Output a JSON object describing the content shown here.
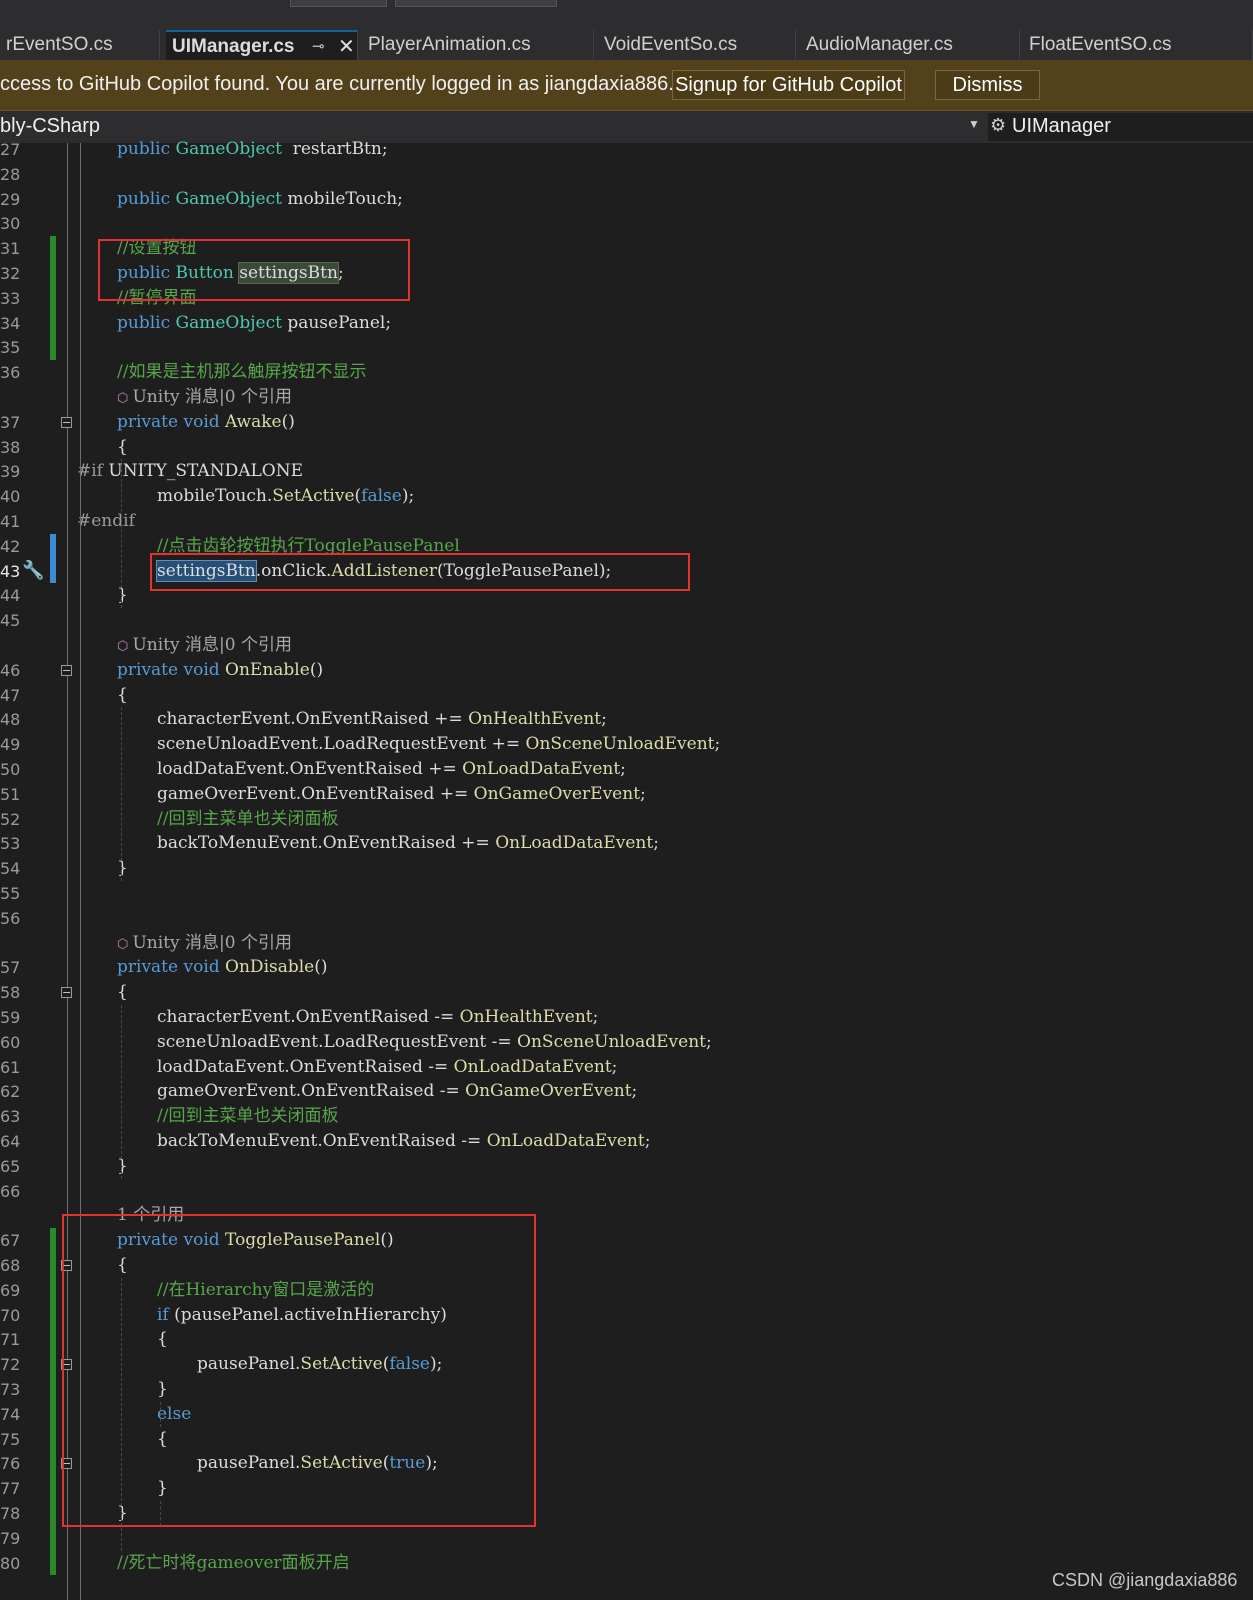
{
  "tabs": [
    {
      "label": "rEventSO.cs",
      "active": false
    },
    {
      "label": "UIManager.cs",
      "active": true
    },
    {
      "label": "PlayerAnimation.cs",
      "active": false
    },
    {
      "label": "VoidEventSo.cs",
      "active": false
    },
    {
      "label": "AudioManager.cs",
      "active": false
    },
    {
      "label": "FloatEventSO.cs",
      "active": false
    }
  ],
  "tab_icons": {
    "pin": "⊸",
    "close": "✕"
  },
  "infobar": {
    "message": "ccess to GitHub Copilot found. You are currently logged in as jiangdaxia886.",
    "signup_label": "Signup for GitHub Copilot",
    "dismiss_label": "Dismiss"
  },
  "navbar": {
    "project": "bly-CSharp",
    "dropdown_arrow": "▼",
    "class_icon": "⚙",
    "class_name": "UIManager"
  },
  "code_lines": [
    {
      "n": "27",
      "indent": 4,
      "tokens": [
        [
          "k",
          "public "
        ],
        [
          "t",
          "GameObject"
        ],
        [
          "",
          "  restartBtn;"
        ]
      ]
    },
    {
      "n": "28",
      "indent": 0,
      "tokens": []
    },
    {
      "n": "29",
      "indent": 4,
      "tokens": [
        [
          "k",
          "public "
        ],
        [
          "t",
          "GameObject"
        ],
        [
          "",
          " mobileTouch;"
        ]
      ]
    },
    {
      "n": "30",
      "indent": 0,
      "tokens": []
    },
    {
      "n": "31",
      "indent": 4,
      "tokens": [
        [
          "c",
          "//设置按钮"
        ]
      ]
    },
    {
      "n": "32",
      "indent": 4,
      "tokens": [
        [
          "k",
          "public "
        ],
        [
          "t",
          "Button"
        ],
        [
          "",
          " "
        ],
        [
          "hl1",
          "settingsBtn"
        ],
        [
          "",
          ";"
        ]
      ]
    },
    {
      "n": "33",
      "indent": 4,
      "tokens": [
        [
          "c",
          "//暂停界面"
        ]
      ]
    },
    {
      "n": "34",
      "indent": 4,
      "tokens": [
        [
          "k",
          "public "
        ],
        [
          "t",
          "GameObject"
        ],
        [
          "",
          " pausePanel;"
        ]
      ]
    },
    {
      "n": "35",
      "indent": 0,
      "tokens": []
    },
    {
      "n": "36",
      "indent": 4,
      "tokens": [
        [
          "c",
          "//如果是主机那么触屏按钮不显示"
        ]
      ]
    },
    {
      "n": "",
      "indent": 4,
      "tokens": [
        [
          "cube",
          "⬡ "
        ],
        [
          "hint",
          "Unity 消息|0 个引用"
        ]
      ]
    },
    {
      "n": "37",
      "indent": 4,
      "tokens": [
        [
          "k",
          "private void "
        ],
        [
          "m",
          "Awake"
        ],
        [
          "",
          "()"
        ]
      ]
    },
    {
      "n": "38",
      "indent": 4,
      "tokens": [
        [
          "",
          "{"
        ]
      ]
    },
    {
      "n": "39",
      "indent": 0,
      "tokens": [
        [
          "p",
          "#if "
        ],
        [
          "",
          "UNITY_STANDALONE"
        ]
      ]
    },
    {
      "n": "40",
      "indent": 8,
      "tokens": [
        [
          "",
          "mobileTouch."
        ],
        [
          "m",
          "SetActive"
        ],
        [
          "",
          "("
        ],
        [
          "k",
          "false"
        ],
        [
          "",
          ");"
        ]
      ]
    },
    {
      "n": "41",
      "indent": 0,
      "tokens": [
        [
          "p",
          "#endif"
        ]
      ]
    },
    {
      "n": "42",
      "indent": 8,
      "tokens": [
        [
          "c",
          "//点击齿轮按钮执行TogglePausePanel"
        ]
      ]
    },
    {
      "n": "43",
      "indent": 8,
      "tokens": [
        [
          "hl2",
          "settingsBtn"
        ],
        [
          "",
          ".onClick."
        ],
        [
          "m",
          "AddListener"
        ],
        [
          "",
          "(TogglePausePanel);"
        ]
      ]
    },
    {
      "n": "44",
      "indent": 4,
      "tokens": [
        [
          "",
          "}"
        ]
      ]
    },
    {
      "n": "45",
      "indent": 0,
      "tokens": []
    },
    {
      "n": "",
      "indent": 4,
      "tokens": [
        [
          "cube",
          "⬡ "
        ],
        [
          "hint",
          "Unity 消息|0 个引用"
        ]
      ]
    },
    {
      "n": "46",
      "indent": 4,
      "tokens": [
        [
          "k",
          "private void "
        ],
        [
          "m",
          "OnEnable"
        ],
        [
          "",
          "()"
        ]
      ]
    },
    {
      "n": "47",
      "indent": 4,
      "tokens": [
        [
          "",
          "{"
        ]
      ]
    },
    {
      "n": "48",
      "indent": 8,
      "tokens": [
        [
          "",
          "characterEvent.OnEventRaised += "
        ],
        [
          "m",
          "OnHealthEvent"
        ],
        [
          "",
          ";"
        ]
      ]
    },
    {
      "n": "49",
      "indent": 8,
      "tokens": [
        [
          "",
          "sceneUnloadEvent.LoadRequestEvent += "
        ],
        [
          "m",
          "OnSceneUnloadEvent"
        ],
        [
          "",
          ";"
        ]
      ]
    },
    {
      "n": "50",
      "indent": 8,
      "tokens": [
        [
          "",
          "loadDataEvent.OnEventRaised += "
        ],
        [
          "m",
          "OnLoadDataEvent"
        ],
        [
          "",
          ";"
        ]
      ]
    },
    {
      "n": "51",
      "indent": 8,
      "tokens": [
        [
          "",
          "gameOverEvent.OnEventRaised += "
        ],
        [
          "m",
          "OnGameOverEvent"
        ],
        [
          "",
          ";"
        ]
      ]
    },
    {
      "n": "52",
      "indent": 8,
      "tokens": [
        [
          "c",
          "//回到主菜单也关闭面板"
        ]
      ]
    },
    {
      "n": "53",
      "indent": 8,
      "tokens": [
        [
          "",
          "backToMenuEvent.OnEventRaised += "
        ],
        [
          "m",
          "OnLoadDataEvent"
        ],
        [
          "",
          ";"
        ]
      ]
    },
    {
      "n": "54",
      "indent": 4,
      "tokens": [
        [
          "",
          "}"
        ]
      ]
    },
    {
      "n": "55",
      "indent": 0,
      "tokens": []
    },
    {
      "n": "56",
      "indent": 0,
      "tokens": []
    },
    {
      "n": "",
      "indent": 4,
      "tokens": [
        [
          "cube",
          "⬡ "
        ],
        [
          "hint",
          "Unity 消息|0 个引用"
        ]
      ]
    },
    {
      "n": "57",
      "indent": 4,
      "tokens": [
        [
          "k",
          "private void "
        ],
        [
          "m",
          "OnDisable"
        ],
        [
          "",
          "()"
        ]
      ]
    },
    {
      "n": "58",
      "indent": 4,
      "tokens": [
        [
          "",
          "{"
        ]
      ]
    },
    {
      "n": "59",
      "indent": 8,
      "tokens": [
        [
          "",
          "characterEvent.OnEventRaised -= "
        ],
        [
          "m",
          "OnHealthEvent"
        ],
        [
          "",
          ";"
        ]
      ]
    },
    {
      "n": "60",
      "indent": 8,
      "tokens": [
        [
          "",
          "sceneUnloadEvent.LoadRequestEvent -= "
        ],
        [
          "m",
          "OnSceneUnloadEvent"
        ],
        [
          "",
          ";"
        ]
      ]
    },
    {
      "n": "61",
      "indent": 8,
      "tokens": [
        [
          "",
          "loadDataEvent.OnEventRaised -= "
        ],
        [
          "m",
          "OnLoadDataEvent"
        ],
        [
          "",
          ";"
        ]
      ]
    },
    {
      "n": "62",
      "indent": 8,
      "tokens": [
        [
          "",
          "gameOverEvent.OnEventRaised -= "
        ],
        [
          "m",
          "OnGameOverEvent"
        ],
        [
          "",
          ";"
        ]
      ]
    },
    {
      "n": "63",
      "indent": 8,
      "tokens": [
        [
          "c",
          "//回到主菜单也关闭面板"
        ]
      ]
    },
    {
      "n": "64",
      "indent": 8,
      "tokens": [
        [
          "",
          "backToMenuEvent.OnEventRaised -= "
        ],
        [
          "m",
          "OnLoadDataEvent"
        ],
        [
          "",
          ";"
        ]
      ]
    },
    {
      "n": "65",
      "indent": 4,
      "tokens": [
        [
          "",
          "}"
        ]
      ]
    },
    {
      "n": "66",
      "indent": 0,
      "tokens": []
    },
    {
      "n": "",
      "indent": 4,
      "tokens": [
        [
          "hint",
          "1 个引用"
        ]
      ]
    },
    {
      "n": "67",
      "indent": 4,
      "tokens": [
        [
          "k",
          "private void "
        ],
        [
          "m",
          "TogglePausePanel"
        ],
        [
          "",
          "()"
        ]
      ]
    },
    {
      "n": "68",
      "indent": 4,
      "tokens": [
        [
          "",
          "{"
        ]
      ]
    },
    {
      "n": "69",
      "indent": 8,
      "tokens": [
        [
          "c",
          "//在Hierarchy窗口是激活的"
        ]
      ]
    },
    {
      "n": "70",
      "indent": 8,
      "tokens": [
        [
          "k",
          "if "
        ],
        [
          "",
          "(pausePanel.activeInHierarchy)"
        ]
      ]
    },
    {
      "n": "71",
      "indent": 8,
      "tokens": [
        [
          "",
          "{"
        ]
      ]
    },
    {
      "n": "72",
      "indent": 12,
      "tokens": [
        [
          "",
          "pausePanel."
        ],
        [
          "m",
          "SetActive"
        ],
        [
          "",
          "("
        ],
        [
          "k",
          "false"
        ],
        [
          "",
          ");"
        ]
      ]
    },
    {
      "n": "73",
      "indent": 8,
      "tokens": [
        [
          "",
          "}"
        ]
      ]
    },
    {
      "n": "74",
      "indent": 8,
      "tokens": [
        [
          "k",
          "else"
        ]
      ]
    },
    {
      "n": "75",
      "indent": 8,
      "tokens": [
        [
          "",
          "{"
        ]
      ]
    },
    {
      "n": "76",
      "indent": 12,
      "tokens": [
        [
          "",
          "pausePanel."
        ],
        [
          "m",
          "SetActive"
        ],
        [
          "",
          "("
        ],
        [
          "k",
          "true"
        ],
        [
          "",
          ");"
        ]
      ]
    },
    {
      "n": "77",
      "indent": 8,
      "tokens": [
        [
          "",
          "}"
        ]
      ]
    },
    {
      "n": "78",
      "indent": 4,
      "tokens": [
        [
          "",
          "}"
        ]
      ]
    },
    {
      "n": "79",
      "indent": 0,
      "tokens": []
    },
    {
      "n": "80",
      "indent": 4,
      "tokens": [
        [
          "c",
          "//死亡时将gameover面板开启"
        ]
      ]
    }
  ],
  "current_line": "43",
  "watermark": "CSDN @jiangdaxia886",
  "colors": {
    "keyword": "#569cd6",
    "type": "#4ec9b0",
    "method": "#dcdcaa",
    "comment": "#57a64a",
    "annotation_box": "#e0322e",
    "change_bar": "#2a8a2a"
  }
}
